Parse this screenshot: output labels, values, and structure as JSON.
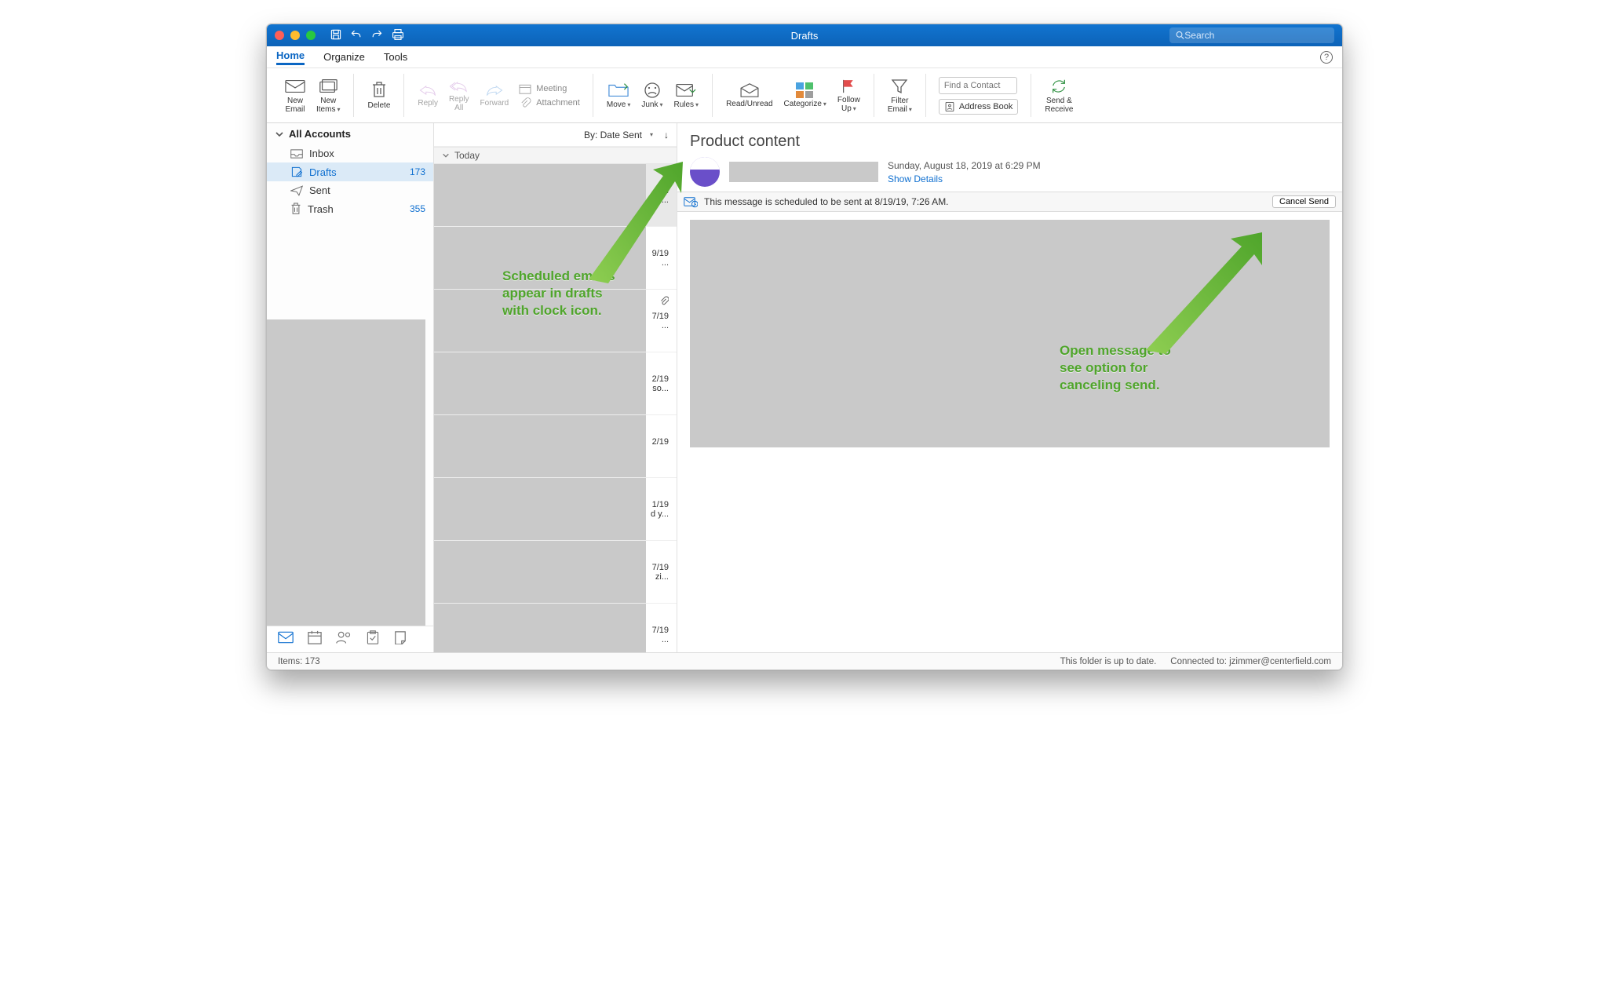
{
  "titlebar": {
    "title": "Drafts",
    "search_placeholder": "Search"
  },
  "menubar": {
    "tabs": [
      "Home",
      "Organize",
      "Tools"
    ],
    "active": 0
  },
  "ribbon": {
    "new_email": "New\nEmail",
    "new_items": "New\nItems",
    "delete": "Delete",
    "reply": "Reply",
    "reply_all": "Reply\nAll",
    "forward": "Forward",
    "meeting": "Meeting",
    "attachment": "Attachment",
    "move": "Move",
    "junk": "Junk",
    "rules": "Rules",
    "read_unread": "Read/Unread",
    "categorize": "Categorize",
    "follow_up": "Follow\nUp",
    "filter_email": "Filter\nEmail",
    "find_contact_placeholder": "Find a Contact",
    "address_book": "Address Book",
    "send_receive": "Send &\nReceive"
  },
  "sidebar": {
    "title": "All Accounts",
    "folders": [
      {
        "name": "Inbox",
        "count": "",
        "icon": "inbox"
      },
      {
        "name": "Drafts",
        "count": "173",
        "icon": "drafts",
        "selected": true
      },
      {
        "name": "Sent",
        "count": "",
        "icon": "sent"
      },
      {
        "name": "Trash",
        "count": "355",
        "icon": "trash"
      }
    ]
  },
  "listpane": {
    "sort_label": "By: Date Sent",
    "group": "Today",
    "items": [
      {
        "selected": true,
        "has_clock": true,
        "date": "PM\nny..."
      },
      {
        "date": "9/19\n..."
      },
      {
        "has_clip": true,
        "date": "7/19\n..."
      },
      {
        "date": "2/19\nso..."
      },
      {
        "date": "2/19"
      },
      {
        "date": "1/19\nd y..."
      },
      {
        "date": "7/19\nzi..."
      },
      {
        "date": "7/19\n..."
      }
    ]
  },
  "reading": {
    "subject": "Product content",
    "date": "Sunday, August 18, 2019 at 6:29 PM",
    "show_details": "Show Details",
    "schedule_msg": "This message is scheduled to be sent at 8/19/19, 7:26 AM.",
    "cancel_send": "Cancel Send"
  },
  "statusbar": {
    "items": "Items: 173",
    "sync": "This folder is up to date.",
    "conn": "Connected to: jzimmer@centerfield.com"
  },
  "annotations": {
    "left": "Scheduled emails\nappear in drafts\nwith clock icon.",
    "right": "Open message to\nsee option for\ncanceling send."
  }
}
